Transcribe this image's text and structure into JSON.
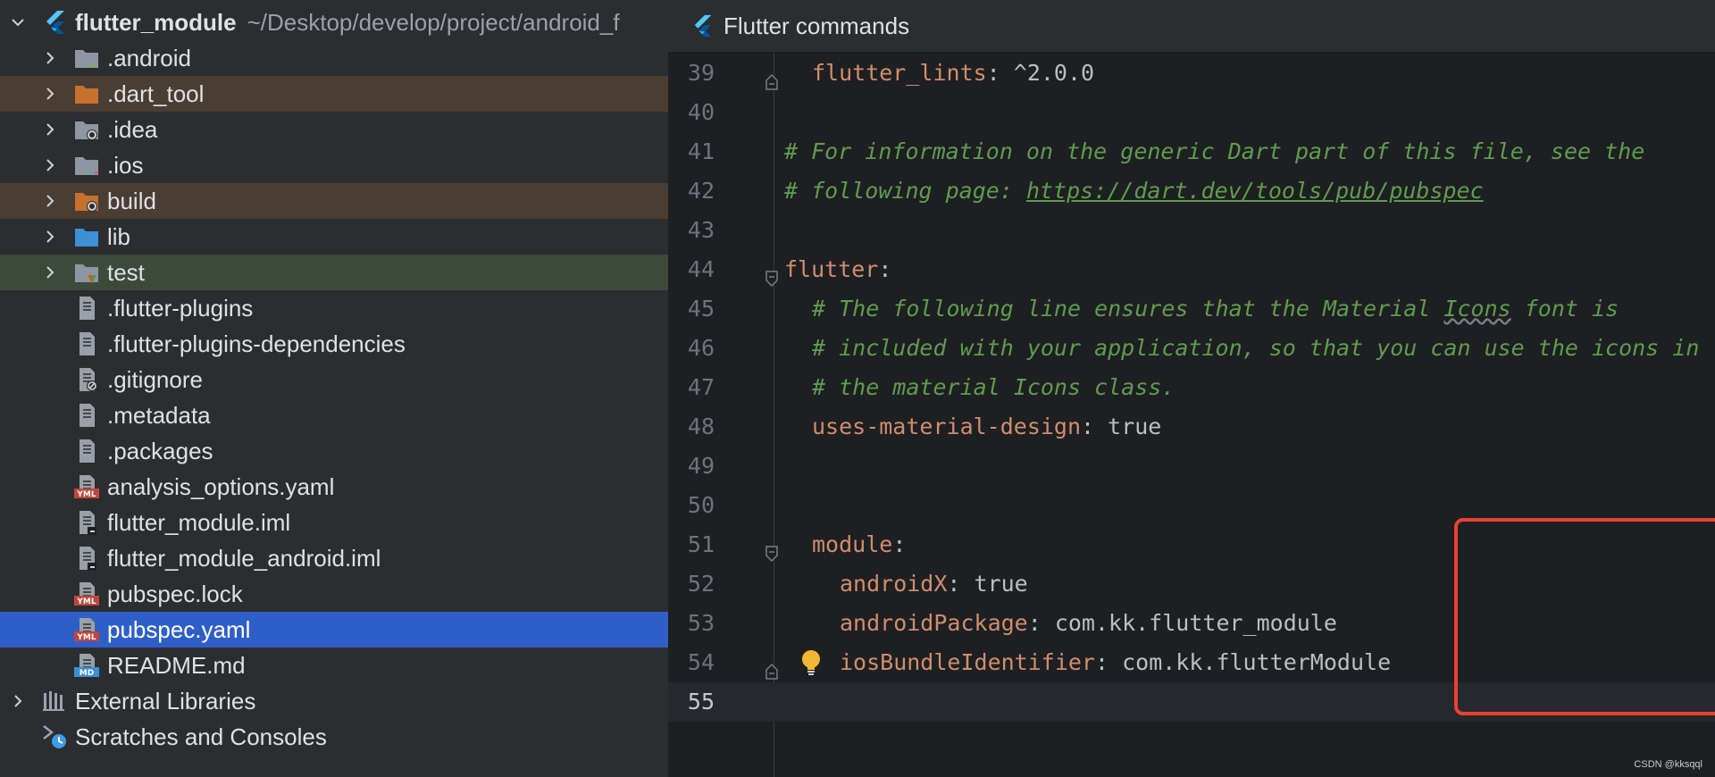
{
  "project_tree": {
    "root": {
      "name": "flutter_module",
      "path": "~/Desktop/develop/project/android_f"
    },
    "items": [
      {
        "label": ".android",
        "icon": "folder-android-icon"
      },
      {
        "label": ".dart_tool",
        "icon": "folder-excluded-icon"
      },
      {
        "label": ".idea",
        "icon": "folder-config-icon"
      },
      {
        "label": ".ios",
        "icon": "folder-ios-icon"
      },
      {
        "label": "build",
        "icon": "folder-build-icon"
      },
      {
        "label": "lib",
        "icon": "folder-source-icon"
      },
      {
        "label": "test",
        "icon": "folder-test-icon"
      },
      {
        "label": ".flutter-plugins",
        "icon": "file-text-icon"
      },
      {
        "label": ".flutter-plugins-dependencies",
        "icon": "file-text-icon"
      },
      {
        "label": ".gitignore",
        "icon": "file-ignore-icon"
      },
      {
        "label": ".metadata",
        "icon": "file-text-icon"
      },
      {
        "label": ".packages",
        "icon": "file-text-icon"
      },
      {
        "label": "analysis_options.yaml",
        "icon": "file-yaml-icon"
      },
      {
        "label": "flutter_module.iml",
        "icon": "file-iml-icon"
      },
      {
        "label": "flutter_module_android.iml",
        "icon": "file-iml-icon"
      },
      {
        "label": "pubspec.lock",
        "icon": "file-yaml-icon"
      },
      {
        "label": "pubspec.yaml",
        "icon": "file-yaml-icon"
      },
      {
        "label": "README.md",
        "icon": "file-markdown-icon"
      }
    ],
    "external_libraries": "External Libraries",
    "scratches": "Scratches and Consoles"
  },
  "editor": {
    "tab_title": "Flutter commands",
    "lines": [
      {
        "n": "39",
        "parts": [
          [
            "k",
            "flutter_lints"
          ],
          [
            "p",
            ": "
          ],
          [
            "v",
            "^2.0.0"
          ]
        ]
      },
      {
        "n": "40",
        "parts": []
      },
      {
        "n": "41",
        "parts": [
          [
            "c",
            "# For information on the generic Dart part of this file, see the"
          ]
        ]
      },
      {
        "n": "42",
        "parts": [
          [
            "c",
            "# following page: "
          ],
          [
            "cu",
            "https://dart.dev/tools/pub/pubspec"
          ]
        ]
      },
      {
        "n": "43",
        "parts": []
      },
      {
        "n": "44",
        "parts": [
          [
            "k",
            "flutter"
          ],
          [
            "p",
            ":"
          ]
        ]
      },
      {
        "n": "45",
        "parts": [
          [
            "c",
            "# The following line ensures that the Material "
          ],
          [
            "cw",
            "Icons"
          ],
          [
            "c",
            " font is"
          ]
        ]
      },
      {
        "n": "46",
        "parts": [
          [
            "c",
            "# included with your application, so that you can use the icons in"
          ]
        ]
      },
      {
        "n": "47",
        "parts": [
          [
            "c",
            "# the material Icons class."
          ]
        ]
      },
      {
        "n": "48",
        "parts": [
          [
            "k",
            "uses-material-design"
          ],
          [
            "p",
            ": "
          ],
          [
            "v",
            "true"
          ]
        ]
      },
      {
        "n": "49",
        "parts": []
      },
      {
        "n": "50",
        "parts": []
      },
      {
        "n": "51",
        "parts": [
          [
            "k",
            "module"
          ],
          [
            "p",
            ":"
          ]
        ]
      },
      {
        "n": "52",
        "parts": [
          [
            "k",
            "androidX"
          ],
          [
            "p",
            ": "
          ],
          [
            "v",
            "true"
          ]
        ]
      },
      {
        "n": "53",
        "parts": [
          [
            "k",
            "androidPackage"
          ],
          [
            "p",
            ": "
          ],
          [
            "v",
            "com.kk.flutter_module"
          ]
        ]
      },
      {
        "n": "54",
        "parts": [
          [
            "k",
            "iosBundleIdentifier"
          ],
          [
            "p",
            ": "
          ],
          [
            "v",
            "com.kk.flutterModule"
          ]
        ]
      },
      {
        "n": "55",
        "parts": []
      }
    ],
    "current_line": "55"
  },
  "watermark": "CSDN @kksqql",
  "colors": {
    "selection": "#2e5fc9",
    "keyword": "#cf8e6d",
    "comment": "#5f9c4f",
    "highlight_box": "#e8432f"
  }
}
